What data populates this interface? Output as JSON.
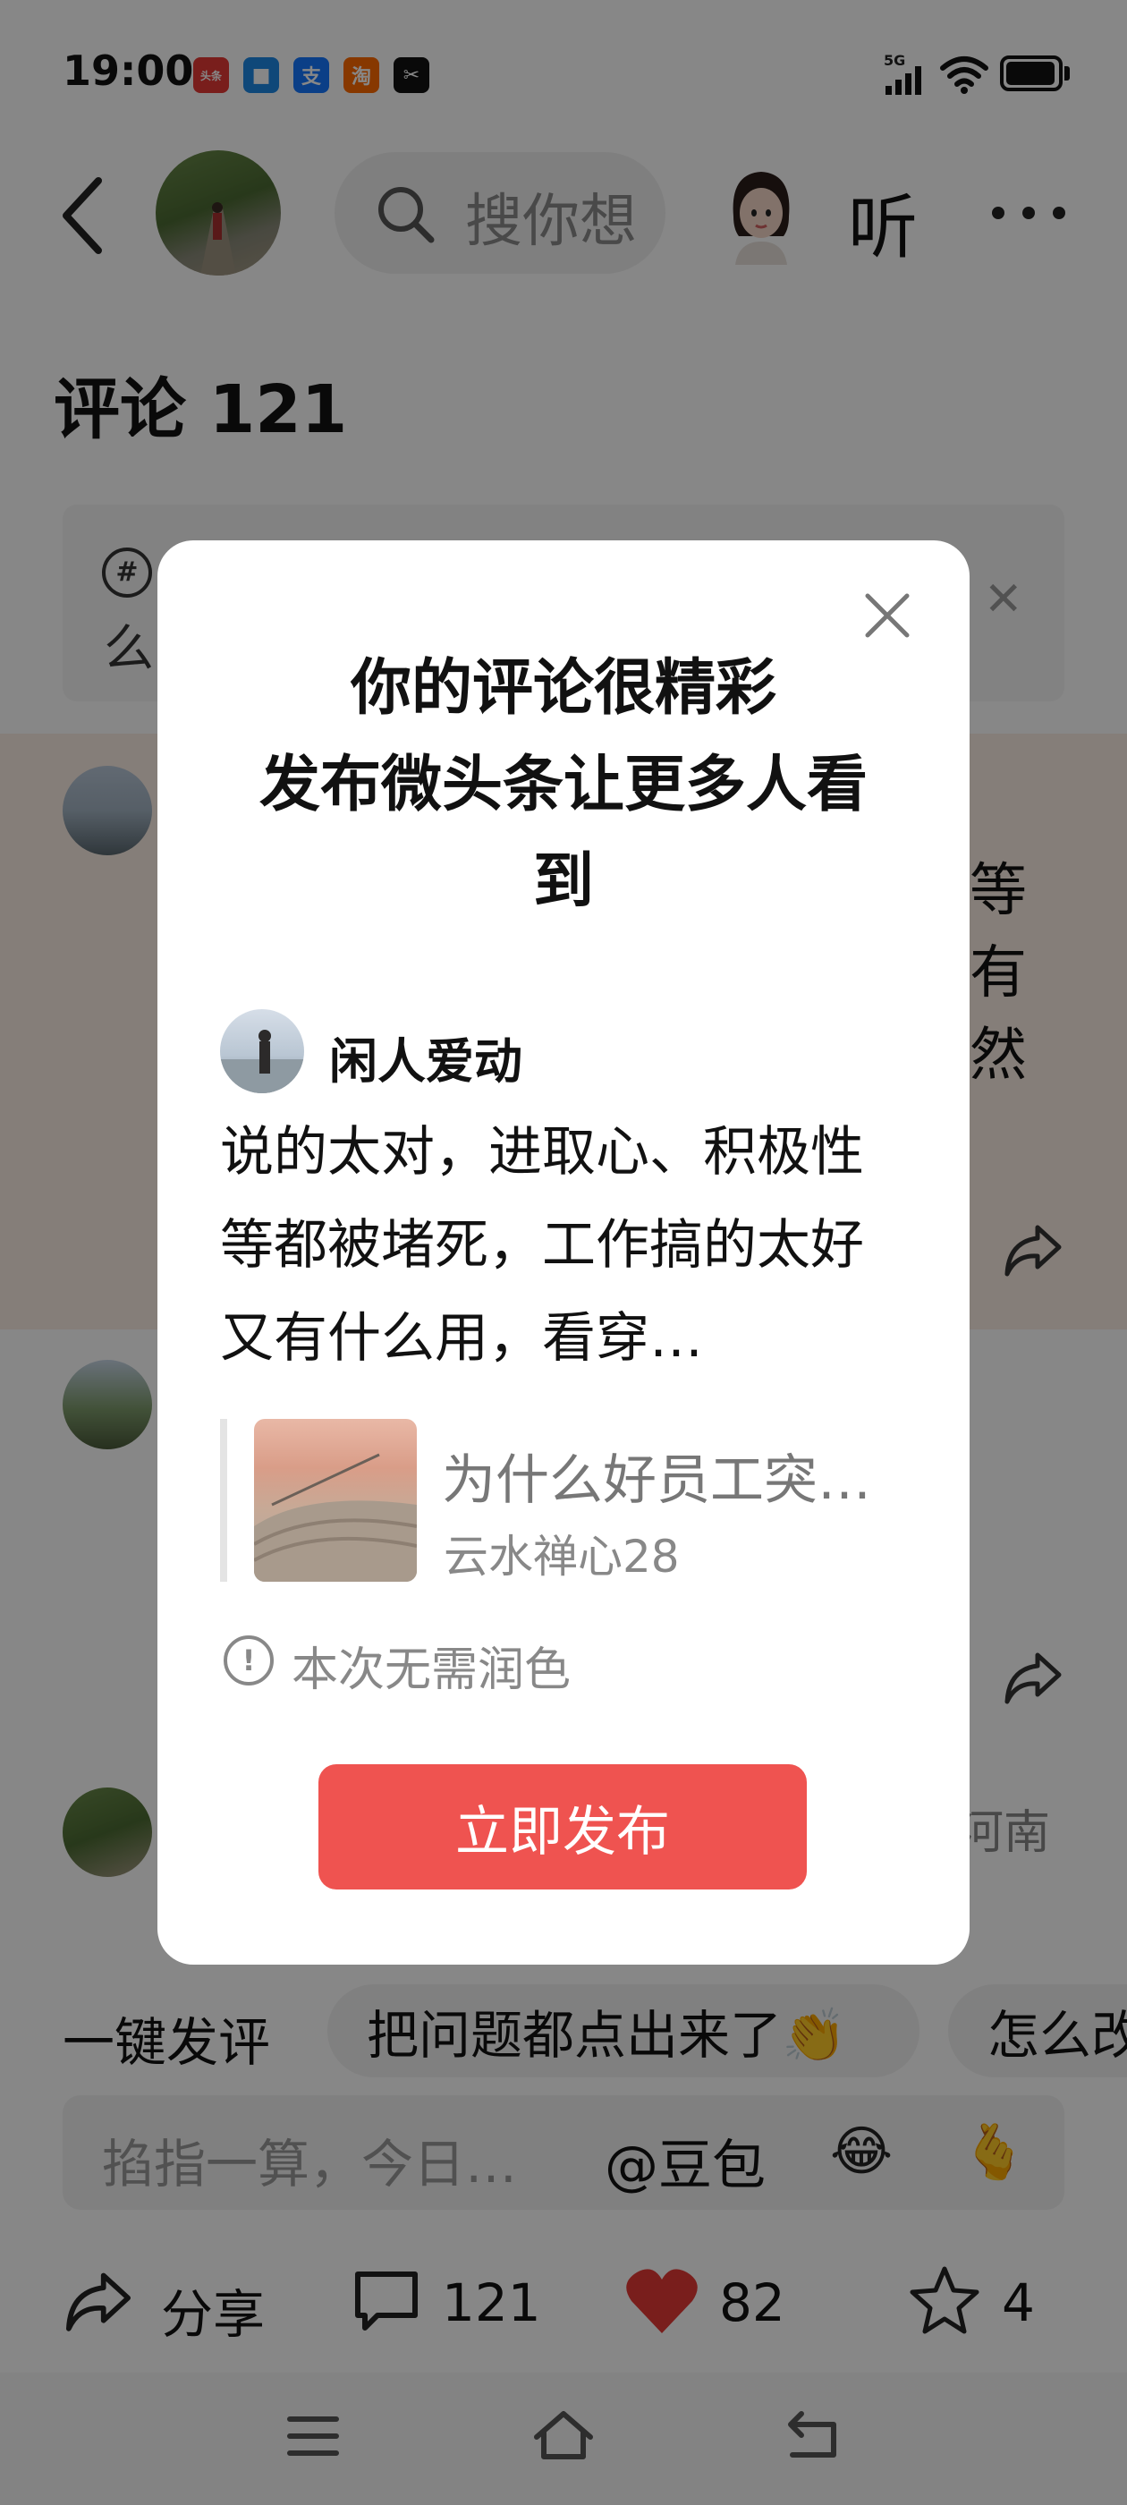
{
  "status_bar": {
    "time": "19:00",
    "app_icons": [
      {
        "name": "toutiao-icon",
        "glyph": "头条",
        "color": "#e53935"
      },
      {
        "name": "lark-icon",
        "glyph": "■",
        "color": "#1e88e5"
      },
      {
        "name": "alipay-icon",
        "glyph": "支",
        "color": "#1677ff"
      },
      {
        "name": "taobao-icon",
        "glyph": "淘",
        "color": "#ff6a00"
      },
      {
        "name": "capcut-icon",
        "glyph": "✂",
        "color": "#111111"
      }
    ],
    "network": "5G"
  },
  "header": {
    "search_placeholder": "搜你想",
    "listen_label": "听"
  },
  "comments_title": "评论 121",
  "topic_prompt": {
    "text": "么"
  },
  "feed": {
    "side_chars": [
      "等",
      "有",
      "然"
    ],
    "region": "河南"
  },
  "quick_reply": {
    "label": "一键发评",
    "chips": [
      "把问题都点出来了👏",
      "怎么改"
    ]
  },
  "comment_input": {
    "placeholder": "掐指一算，今日…",
    "mention": "@豆包",
    "emojis": [
      "😂",
      "🫰"
    ]
  },
  "bottom_bar": {
    "share_label": "分享",
    "comment_count": "121",
    "like_count": "82",
    "favorite_count": "4"
  },
  "modal": {
    "title_line1": "你的评论很精彩",
    "title_line2": "发布微头条让更多人看到",
    "author_name": "闲人爱动",
    "comment_text": "说的太对，进取心、积极性等都被堵死，工作搞的太好又有什么用，看穿…",
    "ref_title": "为什么好员工突…",
    "ref_author": "云水禅心28",
    "notice": "本次无需润色",
    "publish_label": "立即发布"
  },
  "colors": {
    "accent": "#ef5350",
    "like_red": "#e53935",
    "highlight_row": "#fbeee4"
  }
}
